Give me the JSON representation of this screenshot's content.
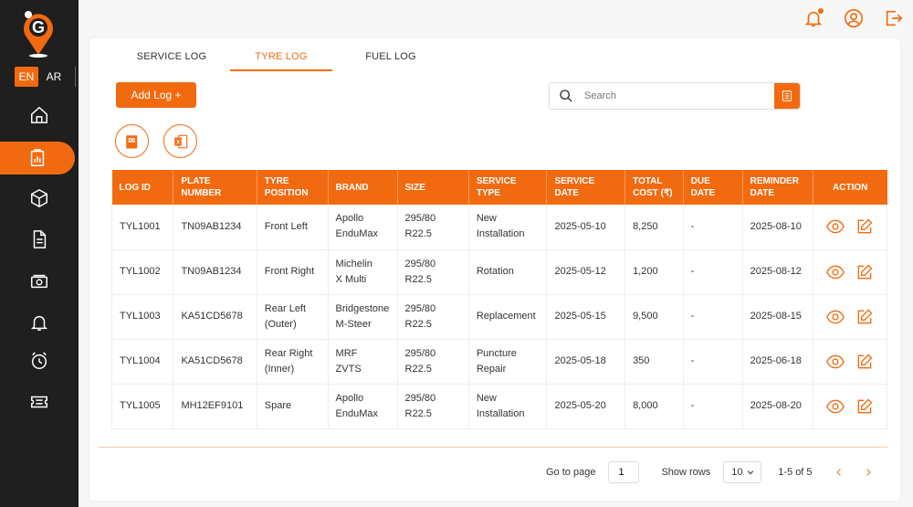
{
  "app": {
    "brand_letter": "G",
    "accent_color": "#f26a10"
  },
  "language": {
    "active": "EN",
    "other": "AR"
  },
  "sidebar": {
    "items": [
      {
        "icon": "home-icon"
      },
      {
        "icon": "clipboard-chart-icon",
        "active": true
      },
      {
        "icon": "box-icon"
      },
      {
        "icon": "document-icon"
      },
      {
        "icon": "cash-icon"
      },
      {
        "icon": "bell-icon"
      },
      {
        "icon": "alarm-clock-icon"
      },
      {
        "icon": "ticket-icon"
      }
    ]
  },
  "topbar": {
    "icons": [
      "notification-icon",
      "profile-icon",
      "logout-icon"
    ]
  },
  "tabs": [
    {
      "label": "SERVICE LOG",
      "active": false
    },
    {
      "label": "TYRE LOG",
      "active": true
    },
    {
      "label": "FUEL LOG",
      "active": false
    }
  ],
  "toolbar": {
    "add_label": "Add Log +",
    "search_placeholder": "Search"
  },
  "exports": [
    "pdf-export-icon",
    "excel-export-icon"
  ],
  "table": {
    "headers": [
      "LOG ID",
      "PLATE NUMBER",
      "TYRE POSITION",
      "BRAND",
      "SIZE",
      "SERVICE TYPE",
      "SERVICE DATE",
      "TOTAL COST (₹)",
      "DUE DATE",
      "REMINDER DATE",
      "ACTION"
    ],
    "rows": [
      {
        "log_id": "TYL1001",
        "plate": "TN09AB1234",
        "position": [
          "Front Left",
          ""
        ],
        "brand": [
          "Apollo",
          "EnduMax"
        ],
        "size": "295/80 R22.5",
        "service": [
          "New",
          "Installation"
        ],
        "service_date": "2025-05-10",
        "cost": "8,250",
        "due": "-",
        "reminder": "2025-08-10"
      },
      {
        "log_id": "TYL1002",
        "plate": "TN09AB1234",
        "position": [
          "Front Right",
          ""
        ],
        "brand": [
          "Michelin",
          "X Multi"
        ],
        "size": "295/80 R22.5",
        "service": [
          "Rotation",
          ""
        ],
        "service_date": "2025-05-12",
        "cost": "1,200",
        "due": "-",
        "reminder": "2025-08-12"
      },
      {
        "log_id": "TYL1003",
        "plate": "KA51CD5678",
        "position": [
          "Rear Left",
          "(Outer)"
        ],
        "brand": [
          "Bridgestone",
          "M-Steer"
        ],
        "size": "295/80 R22.5",
        "service": [
          "Replacement",
          ""
        ],
        "service_date": "2025-05-15",
        "cost": "9,500",
        "due": "-",
        "reminder": "2025-08-15"
      },
      {
        "log_id": "TYL1004",
        "plate": "KA51CD5678",
        "position": [
          "Rear Right",
          "(Inner)"
        ],
        "brand": [
          "MRF",
          "ZVTS"
        ],
        "size": "295/80 R22.5",
        "service": [
          "Puncture",
          "Repair"
        ],
        "service_date": "2025-05-18",
        "cost": "350",
        "due": "-",
        "reminder": "2025-06-18"
      },
      {
        "log_id": "TYL1005",
        "plate": "MH12EF9101",
        "position": [
          "Spare",
          ""
        ],
        "brand": [
          "Apollo",
          "EnduMax"
        ],
        "size": "295/80 R22.5",
        "service": [
          "New",
          "Installation"
        ],
        "service_date": "2025-05-20",
        "cost": "8,000",
        "due": "-",
        "reminder": "2025-08-20"
      }
    ]
  },
  "pagination": {
    "go_to_label": "Go to page",
    "page_value": "1",
    "show_rows_label": "Show rows",
    "rows_value": "10",
    "range": "1-5 of 5"
  }
}
